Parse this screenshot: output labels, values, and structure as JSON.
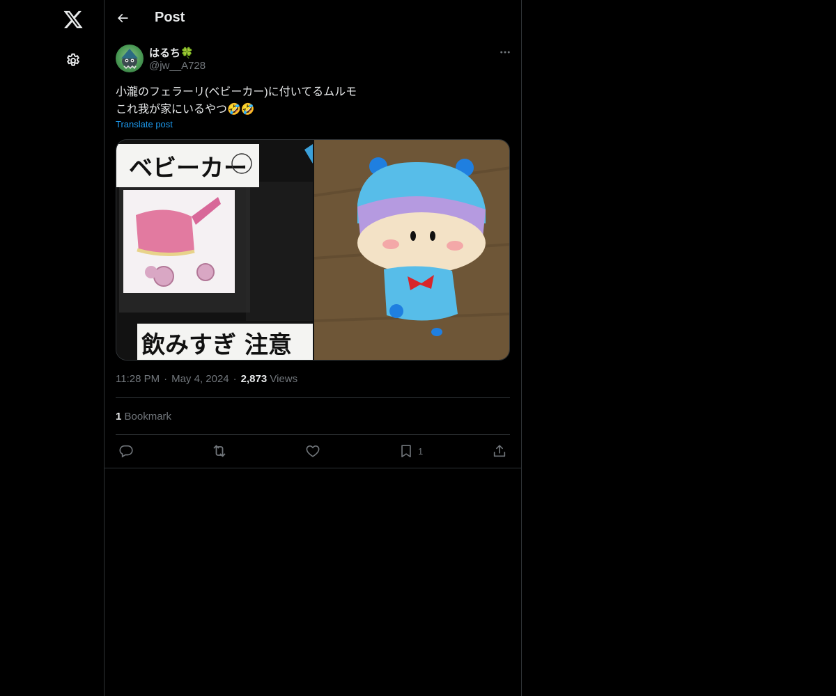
{
  "header": {
    "title": "Post"
  },
  "icons": {
    "logo": "x-logo-icon",
    "settings": "gear-icon",
    "back": "arrow-left-icon",
    "more": "more-horizontal-icon",
    "reply": "reply-icon",
    "repost": "repost-icon",
    "like": "heart-icon",
    "bookmark": "bookmark-icon",
    "share": "share-icon"
  },
  "post": {
    "author_name": "はるち🍀",
    "author_handle": "@jw__A728",
    "text_lines": [
      "小瀧のフェラーリ(ベビーカー)に付いてるムルモ",
      "これ我が家にいるやつ🤣🤣"
    ],
    "translate_label": "Translate post",
    "media": {
      "left_label_top": "ベビーカー",
      "left_label_bottom": "飲みすぎ 注意"
    },
    "time": "11:28 PM",
    "date": "May 4, 2024",
    "views_count": "2,873",
    "views_label": "Views",
    "bookmarks_count": "1",
    "bookmarks_label": "Bookmark",
    "actions": {
      "bookmark_count": "1"
    }
  },
  "colors": {
    "background": "#000000",
    "text": "#e7e9ea",
    "secondary_text": "#71767b",
    "border": "#2f3336",
    "link": "#1d9bf0"
  }
}
